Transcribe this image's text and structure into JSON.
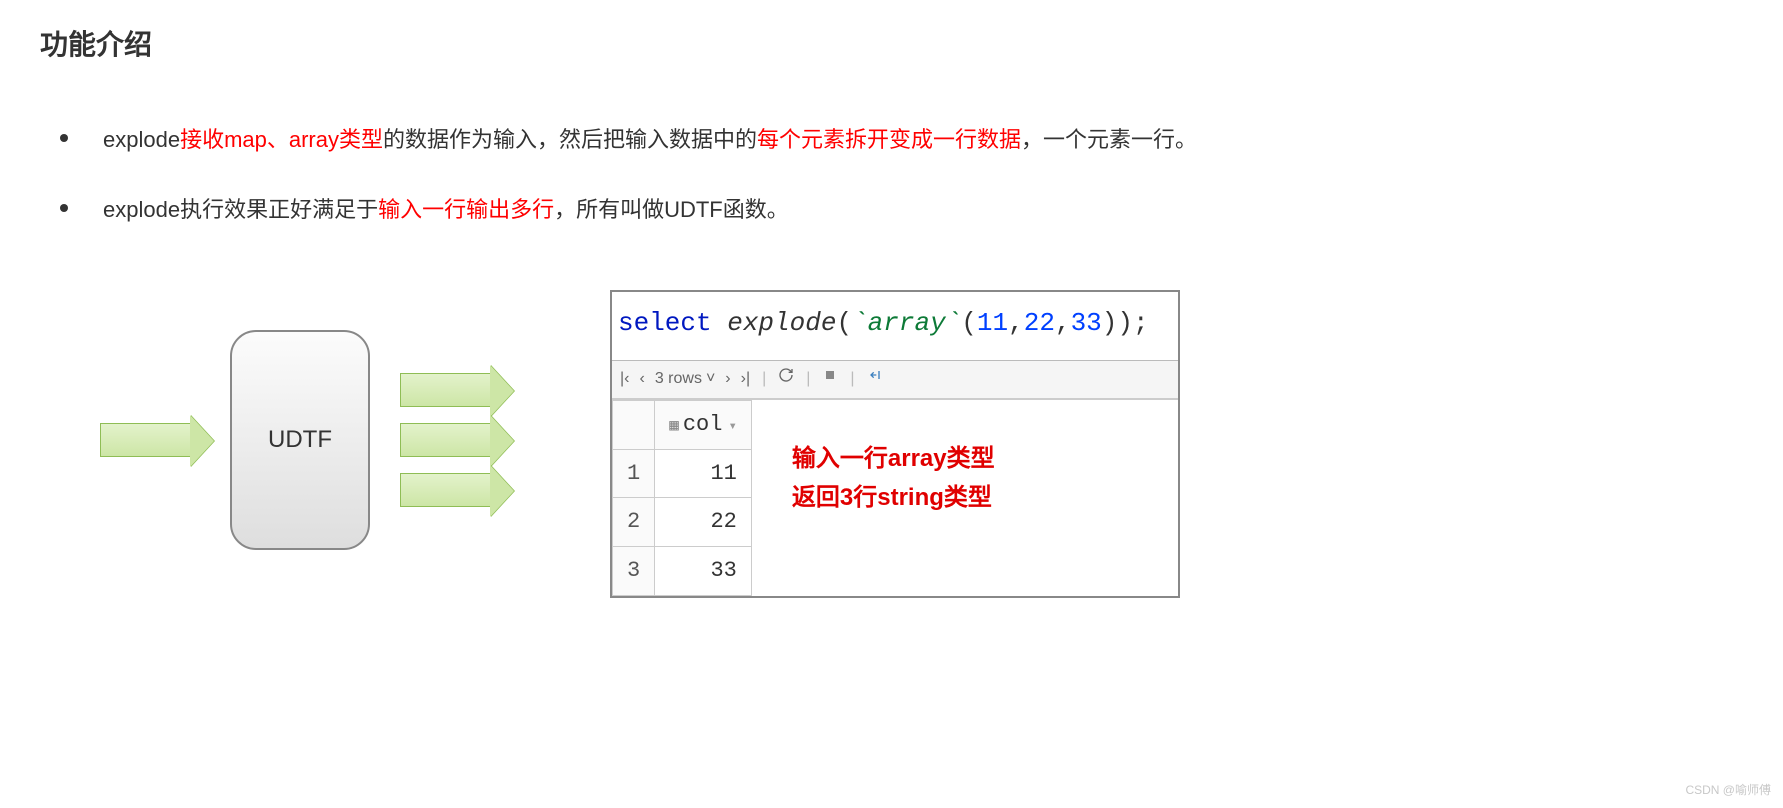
{
  "heading": "功能介绍",
  "bullets": {
    "b1": {
      "p1": "explode",
      "p2_red": "接收map、array类型",
      "p3": "的数据作为输入，然后把输入数据中的",
      "p4_red": "每个元素拆开变成一行数据",
      "p5": "，一个元素一行。"
    },
    "b2": {
      "p1": "explode执行效果正好满足于",
      "p2_red": "输入一行输出多行",
      "p3": "，所有叫做UDTF函数。"
    }
  },
  "diagram": {
    "box_label": "UDTF"
  },
  "code": {
    "select": "select",
    "func": " explode",
    "lp": "(",
    "tick1": "`",
    "arrayword": "array",
    "tick2": "`",
    "lp2": "(",
    "n1": "11",
    "c1": ",",
    "n2": "22",
    "c2": ",",
    "n3": "33",
    "rp": "));"
  },
  "toolbar": {
    "rows_text": "3 rows"
  },
  "table": {
    "col_header": "col",
    "rows": [
      {
        "idx": "1",
        "val": "11"
      },
      {
        "idx": "2",
        "val": "22"
      },
      {
        "idx": "3",
        "val": "33"
      }
    ]
  },
  "annotation": {
    "line1": "输入一行array类型",
    "line2": "返回3行string类型"
  },
  "watermark": "CSDN @喻师傅"
}
